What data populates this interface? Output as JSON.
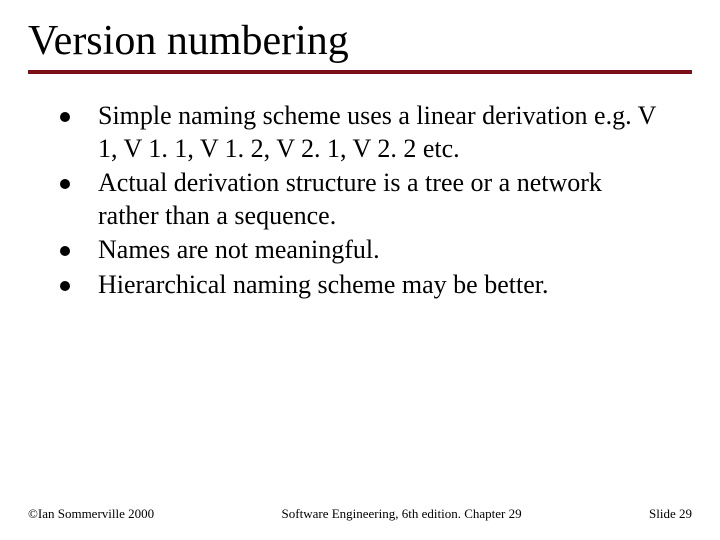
{
  "title": "Version numbering",
  "bullets": [
    "Simple naming scheme uses a linear derivation e.g. V 1, V 1. 1, V 1. 2, V 2. 1, V 2. 2 etc.",
    "Actual derivation structure is a tree or a network rather than a sequence.",
    "Names are not meaningful.",
    "Hierarchical naming scheme may be better."
  ],
  "footer": {
    "left": "©Ian Sommerville 2000",
    "center": "Software Engineering, 6th edition. Chapter 29",
    "right": "Slide 29"
  },
  "accent_color": "#7a0f18"
}
